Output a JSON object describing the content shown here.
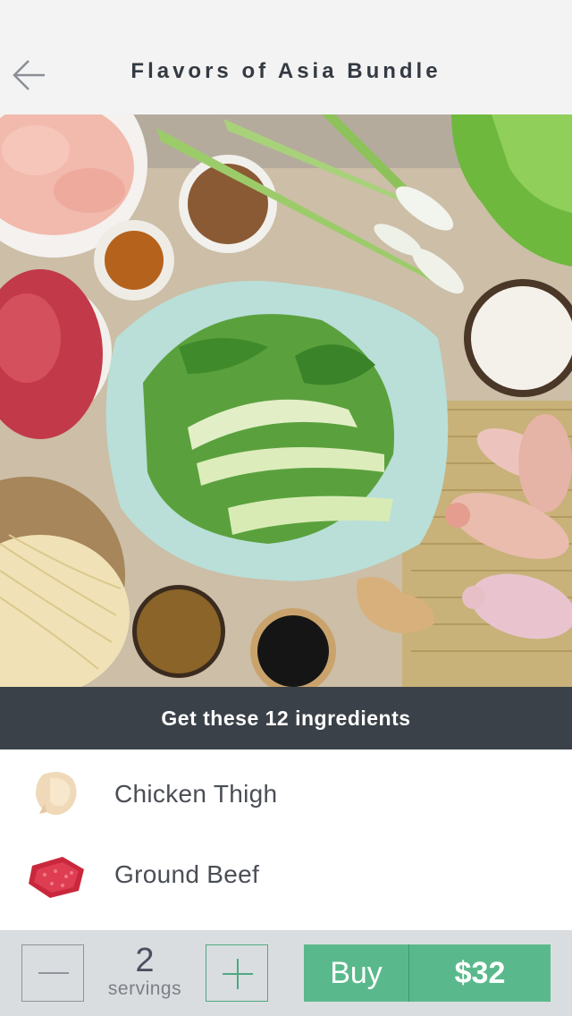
{
  "header": {
    "title": "Flavors of Asia Bundle",
    "back_icon": "arrow-left-icon"
  },
  "hero": {
    "image": "asian-ingredients-flatlay"
  },
  "banner": {
    "text": "Get these 12 ingredients"
  },
  "ingredients": [
    {
      "name": "Chicken Thigh",
      "icon": "chicken-thigh-thumbnail"
    },
    {
      "name": "Ground Beef",
      "icon": "ground-beef-thumbnail"
    }
  ],
  "footer": {
    "servings_count": "2",
    "servings_label": "servings",
    "buy_label": "Buy",
    "price": "$32"
  },
  "colors": {
    "header_bg": "#f3f3f3",
    "banner_bg": "#3b4148",
    "accent_green": "#5ab98c",
    "footer_bg": "#dadde0"
  }
}
